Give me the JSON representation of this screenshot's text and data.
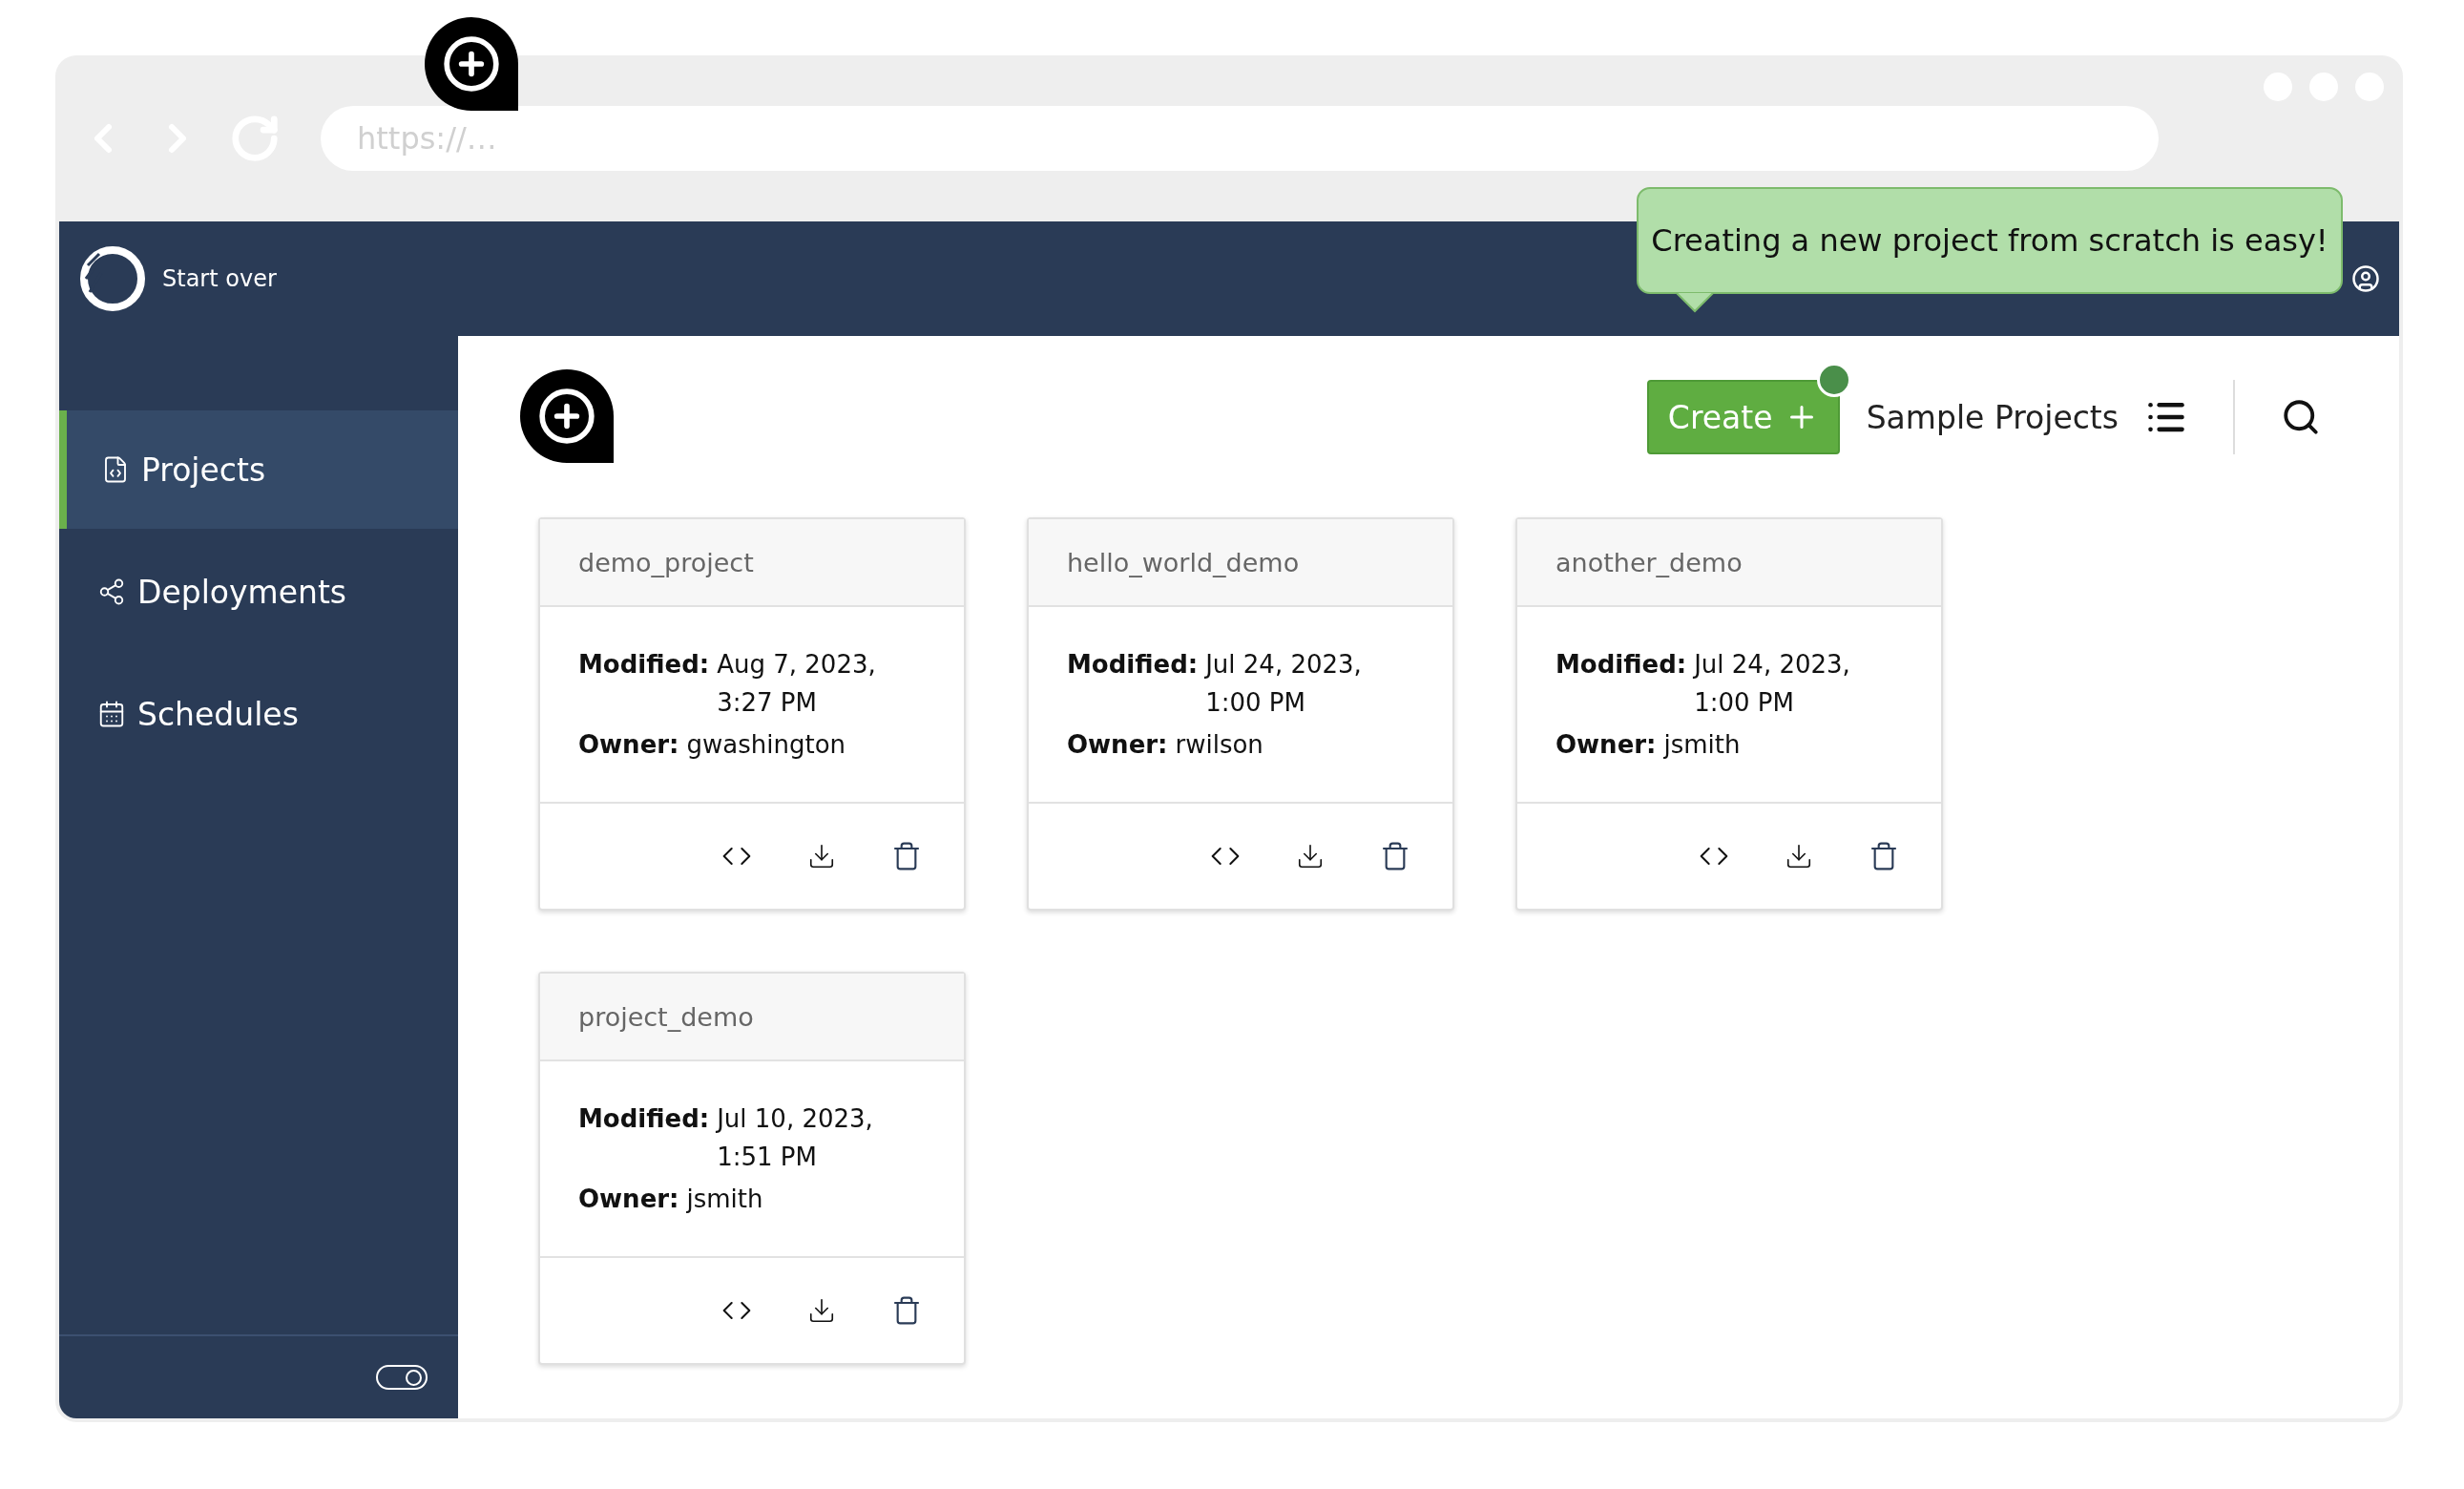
{
  "browser": {
    "address_placeholder": "https://…"
  },
  "header": {
    "brand": "Start over"
  },
  "tooltip": {
    "text": "Creating a new project from scratch is easy!"
  },
  "sidebar": {
    "items": [
      {
        "label": "Projects",
        "selected": true
      },
      {
        "label": "Deployments",
        "selected": false
      },
      {
        "label": "Schedules",
        "selected": false
      }
    ],
    "toggle": {
      "on": true
    }
  },
  "toolbar": {
    "create_label": "Create",
    "create_notification": true,
    "sample_projects": "Sample Projects"
  },
  "projects": [
    {
      "name": "demo_project",
      "modified_label": "Modified:",
      "modified": "Aug 7, 2023, 3:27 PM",
      "owner_label": "Owner:",
      "owner": "gwashington"
    },
    {
      "name": "hello_world_demo",
      "modified_label": "Modified:",
      "modified": "Jul 24, 2023, 1:00 PM",
      "owner_label": "Owner:",
      "owner": "rwilson"
    },
    {
      "name": "another_demo",
      "modified_label": "Modified:",
      "modified": "Jul 24, 2023, 1:00 PM",
      "owner_label": "Owner:",
      "owner": "jsmith"
    },
    {
      "name": "project_demo",
      "modified_label": "Modified:",
      "modified": "Jul 10, 2023, 1:51 PM",
      "owner_label": "Owner:",
      "owner": "jsmith"
    }
  ]
}
